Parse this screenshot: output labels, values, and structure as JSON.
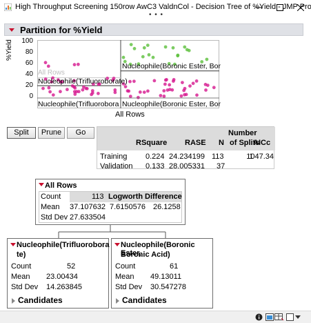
{
  "window": {
    "title": "High Throughput Screening 150row AwC3 ValdnCol - Decision Tree of %Yield - JMP Pro",
    "dots": "• • •"
  },
  "outline": {
    "title": "Partition for %Yield"
  },
  "plot": {
    "y_axis_label": "%Yield",
    "y_ticks": [
      "100",
      "80",
      "60",
      "40",
      "20",
      "0"
    ],
    "all_rows_label": "All Rows",
    "top_left_label": "Nucleophile(Trifluoroborate)",
    "top_right_label": "Nucleophile(Boronic Ester, Bor",
    "bottom_left_label": "Nucleophile(Trifluorobora",
    "bottom_right_label": "Nucleophile(Boronic Ester, Bor",
    "x_axis_label": "All Rows"
  },
  "chart_data": {
    "type": "scatter",
    "ylim": [
      0,
      100
    ],
    "y_ticks": [
      0,
      20,
      40,
      60,
      80,
      100
    ],
    "ylabel": "%Yield",
    "xlabel": "All Rows",
    "groups": [
      {
        "label": "Nucleophile(Trifluoroborate)",
        "color": "#d6188f",
        "mean": 23.0
      },
      {
        "label": "Nucleophile(Boronic Ester, Boronic Acid)",
        "color": "#5bbf3b",
        "mean": 49.1
      }
    ],
    "overall_mean": 37.1
  },
  "buttons": {
    "split": "Split",
    "prune": "Prune",
    "go": "Go"
  },
  "stats_table": {
    "headers": [
      "",
      "RSquare",
      "RASE",
      "N",
      "Number\nof Splits",
      "AICc"
    ],
    "header_number": "Number",
    "header_of_splits": "of Splits",
    "rows": [
      {
        "label": "Training",
        "rsquare": "0.224",
        "rase": "24.234199",
        "n": "113",
        "splits": "1",
        "aicc": "1047.34"
      },
      {
        "label": "Validation",
        "rsquare": "0.133",
        "rase": "28.005331",
        "n": "37",
        "splits": "",
        "aicc": ""
      }
    ]
  },
  "root_node": {
    "title": "All Rows",
    "count_label": "Count",
    "count": "113",
    "logworth_label": "Logworth",
    "logworth": "7.6150576",
    "difference_label": "Difference",
    "difference": "26.1258",
    "mean_label": "Mean",
    "mean": "37.107632",
    "sd_label": "Std Dev",
    "sd": "27.633504"
  },
  "left_node": {
    "title_line1": "Nucleophile(Trifluorobora",
    "title_line2": "te)",
    "count_label": "Count",
    "count": "52",
    "mean_label": "Mean",
    "mean": "23.00434",
    "sd_label": "Std Dev",
    "sd": "14.263845",
    "candidates": "Candidates"
  },
  "right_node": {
    "title_line1": "Nucleophile(Boronic Ester,",
    "title_line2": "Boronic Acid)",
    "count_label": "Count",
    "count": "61",
    "mean_label": "Mean",
    "mean": "49.13011",
    "sd_label": "Std Dev",
    "sd": "30.547278",
    "candidates": "Candidates"
  },
  "colors": {
    "group_a": "#d6188f",
    "group_b": "#5bbf3b",
    "header_bg": "#dfe1e6",
    "red_triangle": "#c8102e"
  }
}
